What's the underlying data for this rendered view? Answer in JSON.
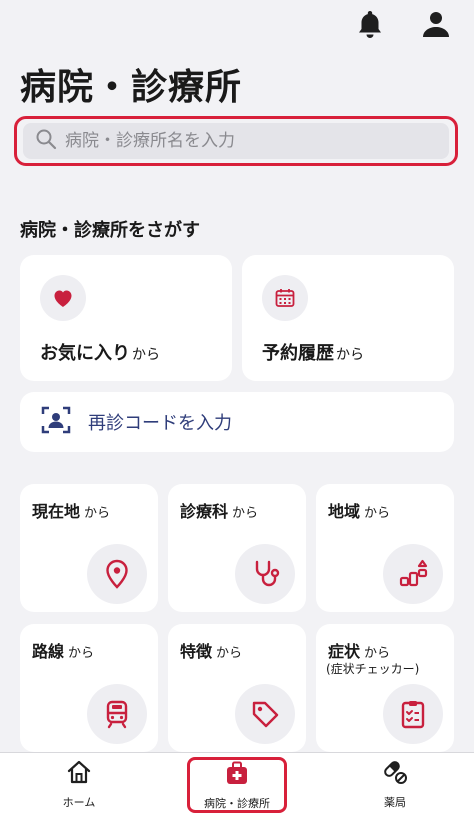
{
  "header": {
    "title": "病院・診療所"
  },
  "search": {
    "placeholder": "病院・診療所名を入力"
  },
  "section": {
    "title": "病院・診療所をさがす"
  },
  "quick_cards": {
    "favorites": {
      "label": "お気に入り",
      "suffix": "から"
    },
    "history": {
      "label": "予約履歴",
      "suffix": "から"
    }
  },
  "revisit": {
    "label": "再診コードを入力"
  },
  "search_by": [
    {
      "title": "現在地",
      "suffix": "から",
      "icon": "location-pin-icon"
    },
    {
      "title": "診療科",
      "suffix": "から",
      "icon": "stethoscope-icon"
    },
    {
      "title": "地域",
      "suffix": "から",
      "icon": "region-blocks-icon"
    },
    {
      "title": "路線",
      "suffix": "から",
      "icon": "train-icon"
    },
    {
      "title": "特徴",
      "suffix": "から",
      "icon": "tag-icon"
    },
    {
      "title": "症状",
      "suffix": "から",
      "sub": "(症状チェッカー)",
      "icon": "clipboard-check-icon"
    }
  ],
  "tabbar": {
    "items": [
      {
        "label": "ホーム",
        "icon": "home-icon"
      },
      {
        "label": "病院・診療所",
        "icon": "hospital-icon",
        "selected": true
      },
      {
        "label": "薬局",
        "icon": "pill-icon"
      }
    ]
  },
  "colors": {
    "accent_red": "#c8203e",
    "navy": "#2f3d7a",
    "background": "#f2f2f5",
    "highlight_frame": "#d8203a"
  }
}
